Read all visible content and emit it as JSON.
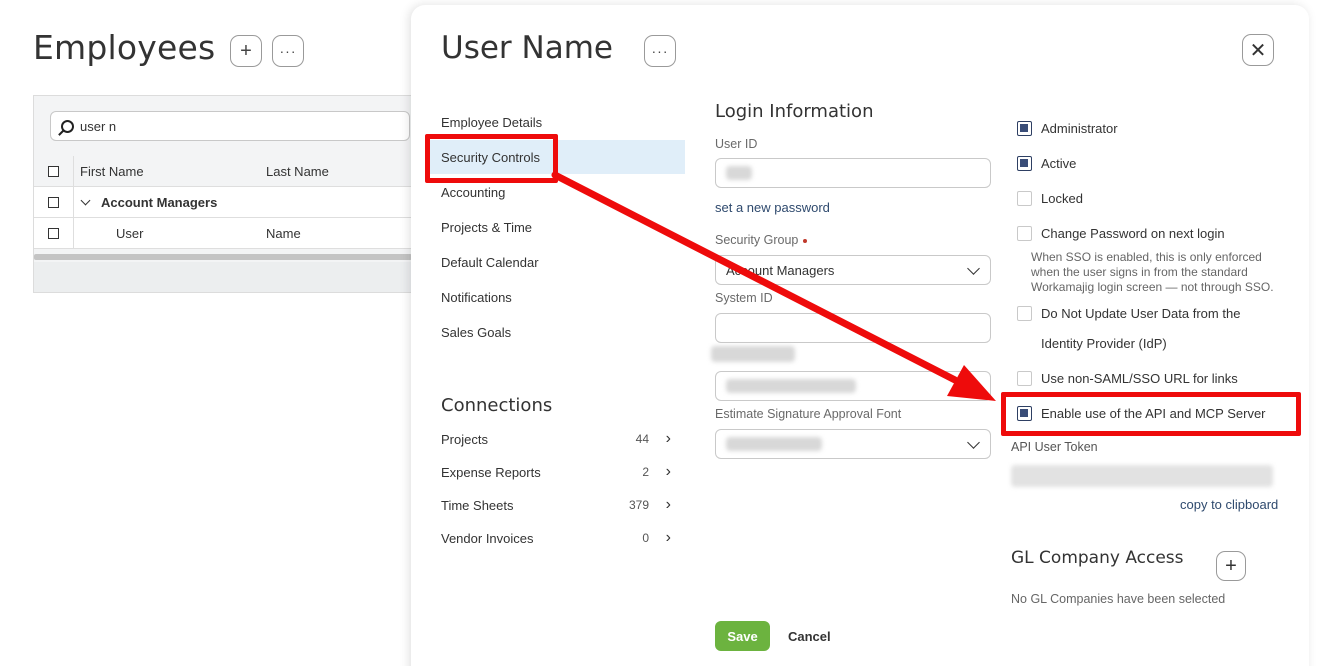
{
  "background": {
    "title": "Employees",
    "add_icon": "plus-icon",
    "more_icon": "ellipsis-icon",
    "search": {
      "value": "user n"
    },
    "columns": [
      "First Name",
      "Last Name"
    ],
    "group": {
      "name": "Account Managers"
    },
    "row": {
      "first": "User",
      "last": "Name"
    }
  },
  "modal": {
    "title": "User Name",
    "nav": [
      "Employee Details",
      "Security Controls",
      "Accounting",
      "Projects & Time",
      "Default Calendar",
      "Notifications",
      "Sales Goals"
    ],
    "active_nav": "Security Controls",
    "connections": {
      "title": "Connections",
      "items": [
        {
          "label": "Projects",
          "count": "44"
        },
        {
          "label": "Expense Reports",
          "count": "2"
        },
        {
          "label": "Time Sheets",
          "count": "379"
        },
        {
          "label": "Vendor Invoices",
          "count": "0"
        }
      ]
    },
    "login": {
      "title": "Login Information",
      "user_id_label": "User ID",
      "set_password": "set a new password",
      "security_group_label": "Security Group",
      "security_group_value": "Account Managers",
      "system_id_label": "System ID",
      "estimate_font_label": "Estimate Signature Approval Font"
    },
    "checks": {
      "administrator": "Administrator",
      "active": "Active",
      "locked": "Locked",
      "change_password": "Change Password on next login",
      "sso_note": "When SSO is enabled, this is only enforced when the user signs in from the standard Workamajig login screen — not through SSO.",
      "no_update_1": "Do Not Update User Data from the",
      "no_update_2": "Identity Provider (IdP)",
      "non_saml": "Use non-SAML/SSO URL for links",
      "api": "Enable use of the API and MCP Server"
    },
    "api_token_label": "API User Token",
    "copy_clipboard": "copy to clipboard",
    "gl": {
      "title": "GL Company Access",
      "none": "No GL Companies have been selected"
    },
    "save": "Save",
    "cancel": "Cancel"
  },
  "annotation_color": "#ee0b0b",
  "accent_green": "#6cb33f",
  "active_nav_bg": "#e0eef9"
}
